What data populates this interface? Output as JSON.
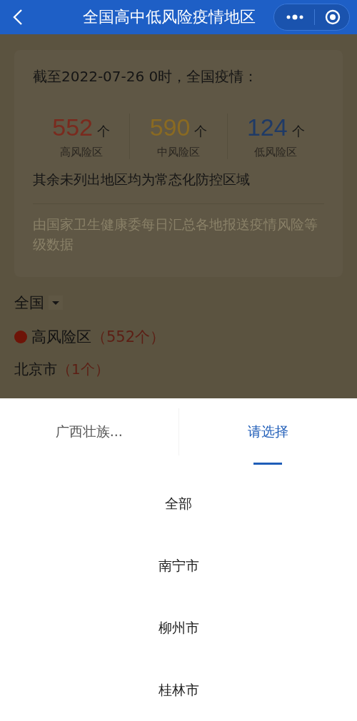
{
  "nav_bar": {
    "title": "全国高中低风险疫情地区"
  },
  "summary": {
    "heading": "截至2022-07-26 0时，全国疫情：",
    "stats": [
      {
        "value": "552",
        "unit": "个",
        "label": "高风险区",
        "color": "#7a2a1e"
      },
      {
        "value": "590",
        "unit": "个",
        "label": "中风险区",
        "color": "#8a6a22"
      },
      {
        "value": "124",
        "unit": "个",
        "label": "低风险区",
        "color": "#1f3a66"
      }
    ],
    "note": "其余未列出地区均为常态化防控区域",
    "source": "由国家卫生健康委每日汇总各地报送疫情风险等级数据"
  },
  "region_selector": {
    "label": "全国"
  },
  "risk_group": {
    "label": "高风险区",
    "count": "（552个）",
    "color": "#6e1408"
  },
  "city": {
    "name": "北京市",
    "count": "（1个）"
  },
  "picker": {
    "tabs": [
      {
        "label": "广西壮族...",
        "selected": false
      },
      {
        "label": "请选择",
        "selected": true
      }
    ],
    "options": [
      "全部",
      "南宁市",
      "柳州市",
      "桂林市"
    ]
  }
}
